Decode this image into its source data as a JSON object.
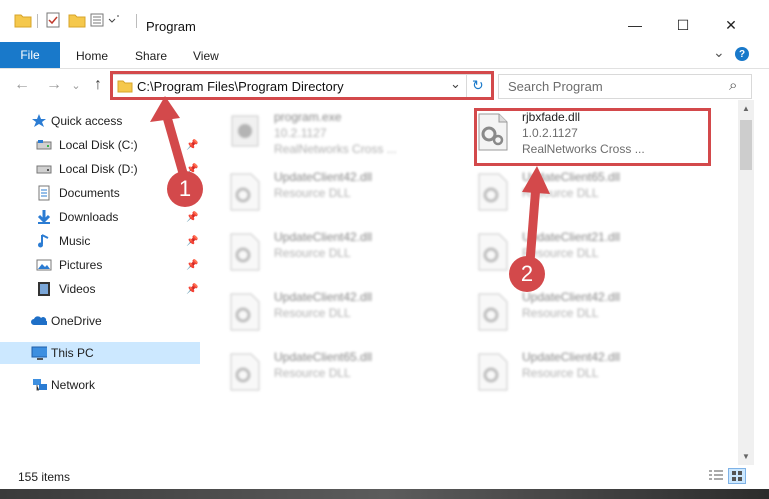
{
  "window": {
    "title": "Program",
    "minimize": "—",
    "maximize": "☐",
    "close": "✕"
  },
  "ribbon": {
    "tabs": [
      "File",
      "Home",
      "Share",
      "View"
    ],
    "expand": "⌄",
    "help": "?"
  },
  "nav": {
    "back": "←",
    "forward": "→",
    "history": "⌄",
    "up": "↑",
    "address": "C:\\Program Files\\Program Directory",
    "address_dropdown": "⌄",
    "refresh": "↻",
    "search_placeholder": "Search Program",
    "search_icon": "⌕"
  },
  "sidebar": {
    "items": [
      {
        "label": "Quick access",
        "icon": "star-icon",
        "pinned": false
      },
      {
        "label": "Local Disk (C:)",
        "icon": "drive-icon",
        "pinned": true
      },
      {
        "label": "Local Disk (D:)",
        "icon": "drive-icon",
        "pinned": true
      },
      {
        "label": "Documents",
        "icon": "documents-icon",
        "pinned": true
      },
      {
        "label": "Downloads",
        "icon": "download-icon",
        "pinned": true
      },
      {
        "label": "Music",
        "icon": "music-icon",
        "pinned": true
      },
      {
        "label": "Pictures",
        "icon": "pictures-icon",
        "pinned": true
      },
      {
        "label": "Videos",
        "icon": "videos-icon",
        "pinned": true
      },
      {
        "label": "OneDrive",
        "icon": "cloud-icon",
        "pinned": false
      },
      {
        "label": "This PC",
        "icon": "computer-icon",
        "pinned": false
      },
      {
        "label": "Network",
        "icon": "network-icon",
        "pinned": false
      }
    ]
  },
  "files": [
    {
      "name": "program.exe",
      "sub1": "10.2.1127",
      "sub2": "RealNetworks Cross ...",
      "highlight": false
    },
    {
      "name": "rjbxfade.dll",
      "sub1": "1.0.2.1127",
      "sub2": "RealNetworks Cross ...",
      "highlight": true
    },
    {
      "name": "UpdateClient42.dll",
      "sub1": "Resource DLL",
      "sub2": "",
      "highlight": false
    },
    {
      "name": "UpdateClient65.dll",
      "sub1": "Resource DLL",
      "sub2": "",
      "highlight": false
    },
    {
      "name": "UpdateClient42.dll",
      "sub1": "Resource DLL",
      "sub2": "",
      "highlight": false
    },
    {
      "name": "UpdateClient21.dll",
      "sub1": "Resource DLL",
      "sub2": "",
      "highlight": false
    },
    {
      "name": "UpdateClient42.dll",
      "sub1": "Resource DLL",
      "sub2": "",
      "highlight": false
    },
    {
      "name": "UpdateClient42.dll",
      "sub1": "Resource DLL",
      "sub2": "",
      "highlight": false
    },
    {
      "name": "UpdateClient65.dll",
      "sub1": "Resource DLL",
      "sub2": "",
      "highlight": false
    },
    {
      "name": "UpdateClient42.dll",
      "sub1": "Resource DLL",
      "sub2": "",
      "highlight": false
    }
  ],
  "status": {
    "item_count": "155 items"
  },
  "callouts": [
    "1",
    "2"
  ],
  "colors": {
    "accent": "#1979ca",
    "callout": "#d3494b",
    "selection": "#cce8ff"
  }
}
